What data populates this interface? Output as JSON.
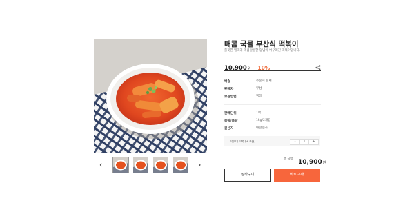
{
  "product": {
    "title": "매콤 국물 부산식 떡볶이",
    "subtitle": "쫄깃한 밀떡과 매콤달콤한 양념이 어우러진 떡볶이입니다.",
    "price": "10,900",
    "currency": "원",
    "discount": "10%"
  },
  "delivery_info": [
    {
      "label": "배송",
      "value": "주문시 결제"
    },
    {
      "label": "판매자",
      "value": "무성"
    },
    {
      "label": "보관방법",
      "value": "냉장"
    }
  ],
  "spec_info": [
    {
      "label": "판매단위",
      "value": "1팩"
    },
    {
      "label": "중량/용량",
      "value": "1kg/2개입"
    },
    {
      "label": "원산지",
      "value": "대한민국"
    }
  ],
  "option": {
    "name": "떡볶이 1팩 (+ 0원)",
    "quantity": "1",
    "minus": "-",
    "plus": "+"
  },
  "total": {
    "label": "총 금액",
    "price": "10,900",
    "currency": "원"
  },
  "buttons": {
    "cart": "장바구니",
    "buy": "바로 구매"
  },
  "gallery": {
    "prev": "‹",
    "next": "›",
    "thumbnails": 4
  },
  "colors": {
    "accent": "#f7663c",
    "discount": "#ef6b3a"
  },
  "icons": {
    "share": "share-icon"
  }
}
